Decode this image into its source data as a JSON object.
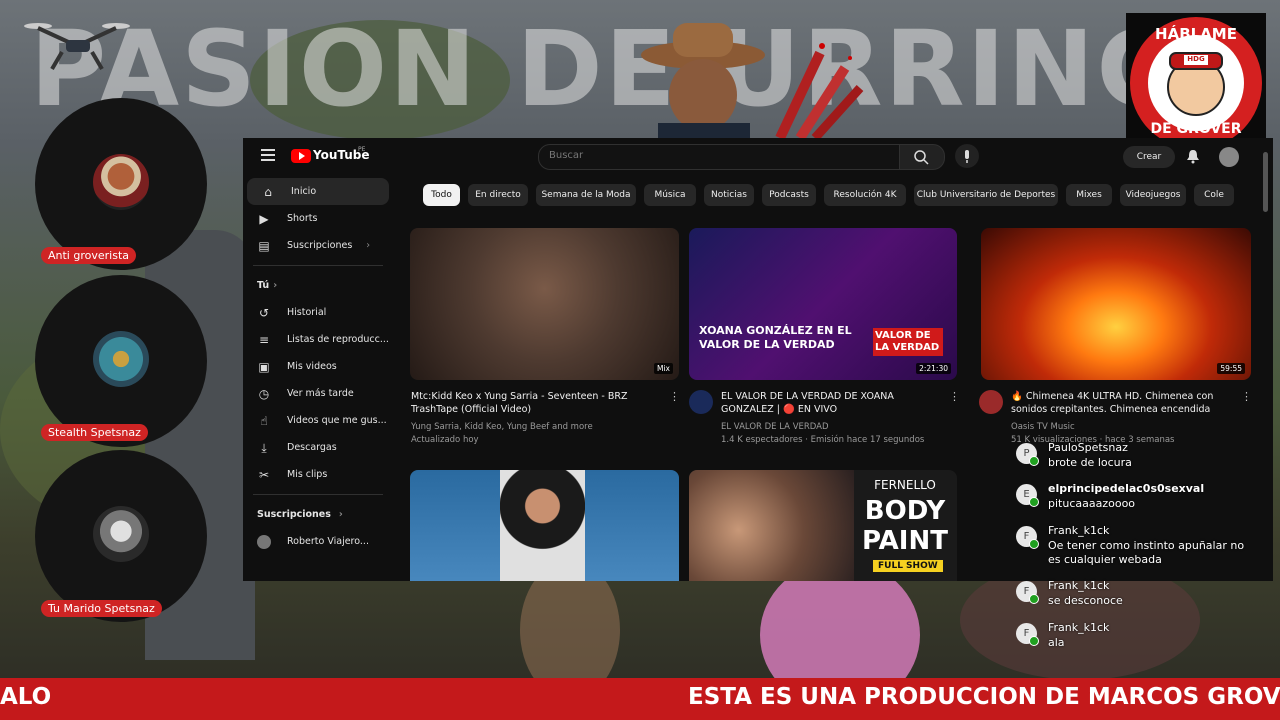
{
  "overlay": {
    "background_title": "PASION DE URRINGA",
    "colors": {
      "red": "#cf2424",
      "ticker": "#c4191b",
      "yt_bg": "#0f0f0f",
      "chat_online": "#20a020"
    },
    "viewers": [
      {
        "name": "Anti groverista",
        "icon": "avatar-portrait"
      },
      {
        "name": "Stealth Spetsnaz",
        "icon": "avatar-serpent"
      },
      {
        "name": "Tu Marido Spetsnaz",
        "icon": "avatar-skull"
      }
    ],
    "logo": {
      "top_text": "HÁBLAME",
      "badge": "HDG",
      "bottom_text": "DE GROVER"
    },
    "ticker": {
      "left_text": "ALO",
      "main_text": "ESTA ES UNA PRODUCCION DE MARCOS GROV"
    }
  },
  "youtube": {
    "brand": "YouTube",
    "country": "PE",
    "search_placeholder": "Buscar",
    "create_label": "Crear",
    "sidebar": [
      {
        "label": "Inicio",
        "icon": "home-icon"
      },
      {
        "label": "Shorts",
        "icon": "shorts-icon"
      },
      {
        "label": "Suscripciones",
        "icon": "subscriptions-icon"
      }
    ],
    "you_label": "Tú",
    "you_items": [
      {
        "label": "Historial",
        "icon": "history-icon"
      },
      {
        "label": "Listas de reproducc...",
        "icon": "playlist-icon"
      },
      {
        "label": "Mis videos",
        "icon": "my-videos-icon"
      },
      {
        "label": "Ver más tarde",
        "icon": "watch-later-icon"
      },
      {
        "label": "Videos que me gus...",
        "icon": "like-icon"
      },
      {
        "label": "Descargas",
        "icon": "download-icon"
      },
      {
        "label": "Mis clips",
        "icon": "clips-icon"
      }
    ],
    "subs_label": "Suscripciones",
    "subs_items": [
      {
        "label": "Roberto Viajero...",
        "icon": "channel-avatar"
      }
    ],
    "chips": [
      "Todo",
      "En directo",
      "Semana de la Moda",
      "Música",
      "Noticias",
      "Podcasts",
      "Resolución 4K",
      "Club Universitario de Deportes",
      "Mixes",
      "Videojuegos",
      "Cole"
    ],
    "videos": [
      {
        "title": "Mtc:Kidd Keo x Yung Sarria - Seventeen - BRZ TrashTape (Official Video)",
        "channel": "Yung Sarria, Kidd Keo, Yung Beef and more",
        "meta": "Actualizado hoy",
        "duration": "Mix"
      },
      {
        "title": "EL VALOR DE LA VERDAD DE XOANA GONZALEZ | 🔴 EN VIVO",
        "channel": "EL VALOR DE LA VERDAD",
        "meta": "1.4 K espectadores · Emisión hace 17 segundos",
        "duration": "2:21:30",
        "thumb_text": "XOANA GONZÁLEZ EN EL VALOR DE LA VERDAD",
        "thumb_badge": "VALOR DE LA VERDAD"
      },
      {
        "title": "🔥 Chimenea 4K ULTRA HD. Chimenea con sonidos crepitantes. Chimenea encendida",
        "channel": "Oasis TV Music",
        "meta": "51 K visualizaciones · hace 3 semanas",
        "duration": "59:55"
      }
    ],
    "bottom_thumbs": [
      {
        "text": "FERNELLO",
        "text2": "BODY",
        "text3": "PAINT",
        "badge": "FULL SHOW"
      }
    ]
  },
  "chat": [
    {
      "initial": "P",
      "name": "PauloSpetsnaz",
      "text": "brote de locura"
    },
    {
      "initial": "E",
      "name": "elprincipedelac0s0sexval",
      "text": "pitucaaaazoooo"
    },
    {
      "initial": "F",
      "name": "Frank_k1ck",
      "text": "Oe tener como instinto apuñalar no es cualquier webada"
    },
    {
      "initial": "F",
      "name": "Frank_k1ck",
      "text": "se desconoce"
    },
    {
      "initial": "F",
      "name": "Frank_k1ck",
      "text": "ala"
    }
  ]
}
